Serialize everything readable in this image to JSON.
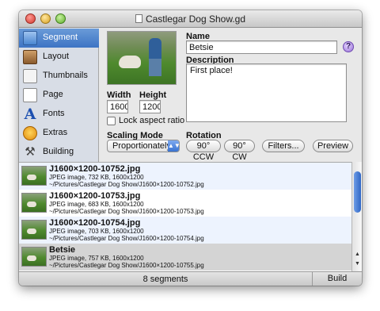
{
  "window": {
    "title": "Castlegar Dog Show.gd"
  },
  "sidebar": {
    "items": [
      {
        "label": "Segment",
        "icon": "segment-icon",
        "selected": true
      },
      {
        "label": "Layout",
        "icon": "layout-icon"
      },
      {
        "label": "Thumbnails",
        "icon": "thumbnails-icon"
      },
      {
        "label": "Page",
        "icon": "page-icon"
      },
      {
        "label": "Fonts",
        "icon": "fonts-icon"
      },
      {
        "label": "Extras",
        "icon": "extras-icon"
      },
      {
        "label": "Building",
        "icon": "building-icon"
      }
    ]
  },
  "editor": {
    "name_label": "Name",
    "name_value": "Betsie",
    "description_label": "Description",
    "description_value": "First place!",
    "width_label": "Width",
    "width_value": "1600",
    "height_label": "Height",
    "height_value": "1200",
    "times_symbol": "x",
    "aspect_label": "Lock aspect ratio",
    "aspect_checked": false,
    "scaling_label": "Scaling Mode",
    "scaling_value": "Proportionately",
    "rotation_label": "Rotation",
    "rotate_ccw": "90° CCW",
    "rotate_cw": "90° CW",
    "filters": "Filters...",
    "preview": "Preview",
    "help_symbol": "?"
  },
  "segments": [
    {
      "title": "J1600×1200-10752.jpg",
      "info": "JPEG image, 732 KB, 1600x1200",
      "path": "~/Pictures/Castlegar Dog Show/J1600×1200-10752.jpg",
      "selected": false
    },
    {
      "title": "J1600×1200-10753.jpg",
      "info": "JPEG image, 683 KB, 1600x1200",
      "path": "~/Pictures/Castlegar Dog Show/J1600×1200-10753.jpg",
      "selected": false
    },
    {
      "title": "J1600×1200-10754.jpg",
      "info": "JPEG image, 703 KB, 1600x1200",
      "path": "~/Pictures/Castlegar Dog Show/J1600×1200-10754.jpg",
      "selected": false
    },
    {
      "title": "Betsie",
      "info": "JPEG image, 757 KB, 1600x1200",
      "path": "~/Pictures/Castlegar Dog Show/J1600×1200-10755.jpg",
      "selected": true
    }
  ],
  "status": {
    "count_text": "8 segments",
    "build_label": "Build"
  },
  "colors": {
    "selection_blue": "#3d74c4",
    "accent": "#2f66c4"
  }
}
